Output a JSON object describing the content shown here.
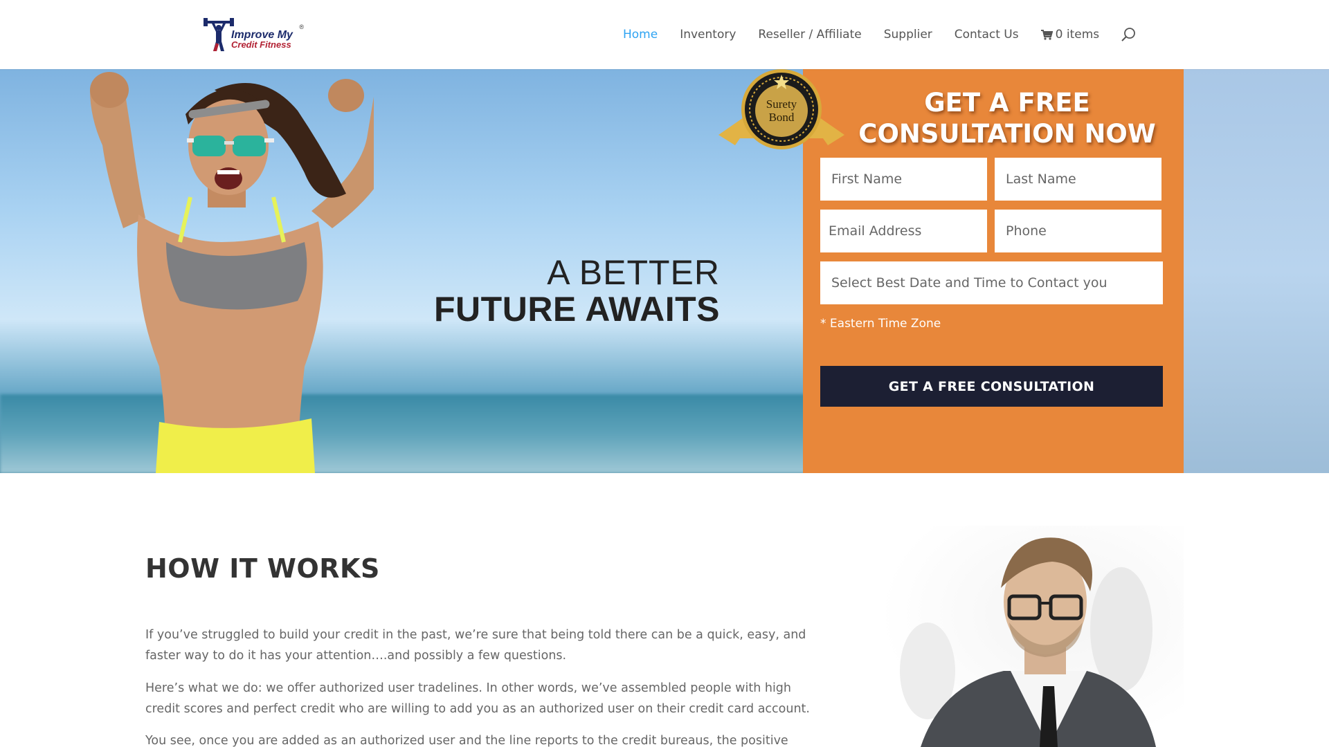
{
  "brand": {
    "logo_line1": "Improve My",
    "logo_line2": "Credit Fitness",
    "logo_reg": "®"
  },
  "nav": {
    "items": [
      {
        "label": "Home",
        "active": true
      },
      {
        "label": "Inventory"
      },
      {
        "label": "Reseller / Affiliate"
      },
      {
        "label": "Supplier"
      },
      {
        "label": "Contact Us"
      }
    ],
    "cart_label": "0 items",
    "cart_icon": "shopping-cart-icon",
    "search_icon": "search-icon"
  },
  "hero": {
    "headline_line1": "A BETTER",
    "headline_line2": "FUTURE AWAITS",
    "seal_line1": "Surety",
    "seal_line2": "Bond"
  },
  "form": {
    "title_line1": "GET A FREE",
    "title_line2": "CONSULTATION NOW",
    "first_name_placeholder": "First Name",
    "last_name_placeholder": "Last Name",
    "email_placeholder": "Email Address",
    "phone_placeholder": "Phone",
    "datetime_placeholder": "Select Best Date and Time to Contact you",
    "timezone_note": "* Eastern Time Zone",
    "submit_label": "GET A FREE CONSULTATION"
  },
  "how_it_works": {
    "title": "HOW IT WORKS",
    "paragraphs": [
      "If you’ve struggled to build your credit in the past, we’re sure that being told there can be a quick, easy, and faster way to do it has your attention….and possibly a few questions.",
      "Here’s what we do: we offer authorized user tradelines. In other words, we’ve assembled people with high credit scores and perfect credit who are willing to add you as an authorized user on their credit card account.",
      "You see, once you are added as an authorized user and the line reports to the credit bureaus, the positive credit history"
    ]
  },
  "colors": {
    "accent_nav": "#2ea3f2",
    "panel_orange": "#e8873a",
    "cta_navy": "#1c1f33"
  }
}
